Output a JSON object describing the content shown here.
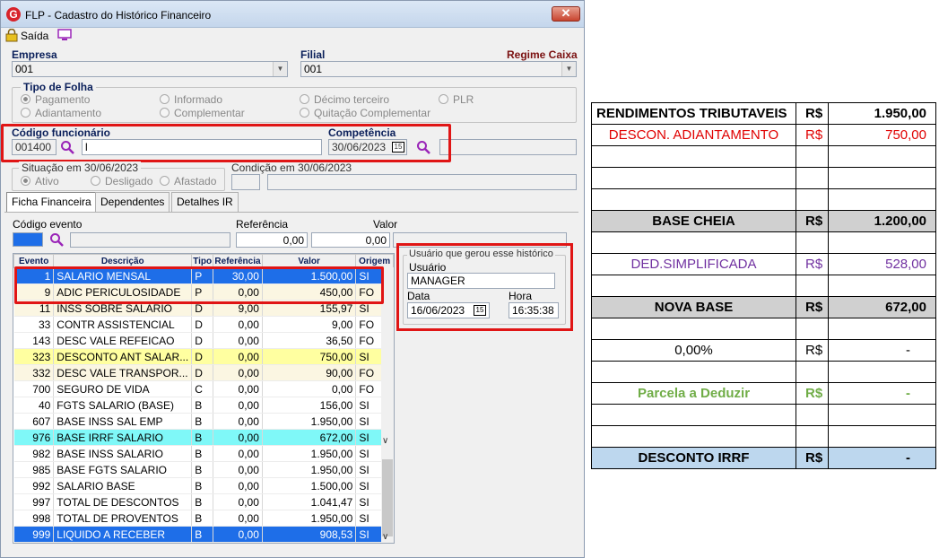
{
  "window": {
    "title": "FLP - Cadastro do Histórico Financeiro",
    "logo": "G",
    "close_label": "✕"
  },
  "toolbar": {
    "exit_label": "Saída"
  },
  "empresa": {
    "label": "Empresa",
    "value": "001"
  },
  "filial": {
    "label": "Filial",
    "value": "001",
    "regime": "Regime Caixa"
  },
  "tipo_folha": {
    "label": "Tipo de Folha",
    "options": [
      "Pagamento",
      "Informado",
      "Décimo terceiro",
      "PLR",
      "Adiantamento",
      "Complementar",
      "Quitação Complementar"
    ],
    "selected": "Pagamento"
  },
  "funcionario": {
    "label": "Código funcionário",
    "code": "001400",
    "name": "l"
  },
  "competencia": {
    "label": "Competência",
    "value": "30/06/2023",
    "cal": "15"
  },
  "situacao": {
    "label": "Situação em  30/06/2023",
    "options": [
      "Ativo",
      "Desligado",
      "Afastado"
    ],
    "selected": "Ativo"
  },
  "condicao": {
    "label": "Condição em 30/06/2023"
  },
  "tabs": [
    "Ficha Financeira",
    "Dependentes",
    "Detalhes IR"
  ],
  "evento_form": {
    "codigo_label": "Código evento",
    "ref_label": "Referência",
    "ref_value": "0,00",
    "valor_label": "Valor",
    "valor_value": "0,00"
  },
  "usuario_box": {
    "title": "Usuário que gerou esse histórico",
    "usuario_label": "Usuário",
    "usuario_value": "MANAGER",
    "data_label": "Data",
    "data_value": "16/06/2023",
    "data_cal": "15",
    "hora_label": "Hora",
    "hora_value": "16:35:38"
  },
  "grid": {
    "columns": [
      "Evento",
      "Descrição",
      "Tipo",
      "Referência",
      "Valor",
      "Origem"
    ],
    "rows": [
      {
        "evento": "1",
        "descricao": "SALARIO MENSAL",
        "tipo": "P",
        "ref": "30,00",
        "valor": "1.500,00",
        "origem": "SI",
        "style": "sel"
      },
      {
        "evento": "9",
        "descricao": "ADIC PERICULOSIDADE",
        "tipo": "P",
        "ref": "0,00",
        "valor": "450,00",
        "origem": "FO",
        "style": "cream"
      },
      {
        "evento": "11",
        "descricao": "INSS SOBRE SALARIO",
        "tipo": "D",
        "ref": "9,00",
        "valor": "155,97",
        "origem": "SI",
        "style": "cream"
      },
      {
        "evento": "33",
        "descricao": "CONTR ASSISTENCIAL",
        "tipo": "D",
        "ref": "0,00",
        "valor": "9,00",
        "origem": "FO",
        "style": "white"
      },
      {
        "evento": "143",
        "descricao": "DESC VALE REFEICAO",
        "tipo": "D",
        "ref": "0,00",
        "valor": "36,50",
        "origem": "FO",
        "style": "white"
      },
      {
        "evento": "323",
        "descricao": "DESCONTO ANT SALAR...",
        "tipo": "D",
        "ref": "0,00",
        "valor": "750,00",
        "origem": "SI",
        "style": "yellow"
      },
      {
        "evento": "332",
        "descricao": "DESC VALE TRANSPOR...",
        "tipo": "D",
        "ref": "0,00",
        "valor": "90,00",
        "origem": "FO",
        "style": "cream"
      },
      {
        "evento": "700",
        "descricao": "SEGURO DE VIDA",
        "tipo": "C",
        "ref": "0,00",
        "valor": "0,00",
        "origem": "FO",
        "style": "white"
      },
      {
        "evento": "40",
        "descricao": "FGTS SALARIO (BASE)",
        "tipo": "B",
        "ref": "0,00",
        "valor": "156,00",
        "origem": "SI",
        "style": "white"
      },
      {
        "evento": "607",
        "descricao": "BASE INSS SAL EMP",
        "tipo": "B",
        "ref": "0,00",
        "valor": "1.950,00",
        "origem": "SI",
        "style": "white"
      },
      {
        "evento": "976",
        "descricao": "BASE IRRF SALARIO",
        "tipo": "B",
        "ref": "0,00",
        "valor": "672,00",
        "origem": "SI",
        "style": "cyan"
      },
      {
        "evento": "982",
        "descricao": "BASE INSS SALARIO",
        "tipo": "B",
        "ref": "0,00",
        "valor": "1.950,00",
        "origem": "SI",
        "style": "white"
      },
      {
        "evento": "985",
        "descricao": "BASE FGTS SALARIO",
        "tipo": "B",
        "ref": "0,00",
        "valor": "1.950,00",
        "origem": "SI",
        "style": "white"
      },
      {
        "evento": "992",
        "descricao": "SALARIO BASE",
        "tipo": "B",
        "ref": "0,00",
        "valor": "1.500,00",
        "origem": "SI",
        "style": "white"
      },
      {
        "evento": "997",
        "descricao": "TOTAL DE DESCONTOS",
        "tipo": "B",
        "ref": "0,00",
        "valor": "1.041,47",
        "origem": "SI",
        "style": "white"
      },
      {
        "evento": "998",
        "descricao": "TOTAL DE PROVENTOS",
        "tipo": "B",
        "ref": "0,00",
        "valor": "1.950,00",
        "origem": "SI",
        "style": "white"
      },
      {
        "evento": "999",
        "descricao": "LIQUIDO A RECEBER",
        "tipo": "B",
        "ref": "0,00",
        "valor": "908,53",
        "origem": "SI",
        "style": "blue"
      }
    ]
  },
  "calc": {
    "currency": "R$",
    "rows": [
      {
        "label": "RENDIMENTOS TRIBUTAVEIS",
        "value": "1.950,00",
        "color": "#000000",
        "bold": true,
        "bg": "#ffffff",
        "cur": true,
        "align": "left"
      },
      {
        "label": "DESCON. ADIANTAMENTO",
        "value": "750,00",
        "color": "#e00000",
        "bold": false,
        "bg": "#ffffff",
        "cur": true,
        "align": "center"
      },
      {
        "label": "",
        "value": "",
        "bg": "#ffffff"
      },
      {
        "label": "",
        "value": "",
        "bg": "#ffffff"
      },
      {
        "label": "",
        "value": "",
        "bg": "#ffffff"
      },
      {
        "label": "BASE CHEIA",
        "value": "1.200,00",
        "color": "#000000",
        "bold": true,
        "bg": "#d0d0d0",
        "cur": true,
        "align": "center"
      },
      {
        "label": "",
        "value": "",
        "bg": "#ffffff"
      },
      {
        "label": "DED.SIMPLIFICADA",
        "value": "528,00",
        "color": "#7030a0",
        "bold": false,
        "bg": "#ffffff",
        "cur": true,
        "align": "center"
      },
      {
        "label": "",
        "value": "",
        "bg": "#ffffff"
      },
      {
        "label": "NOVA BASE",
        "value": "672,00",
        "color": "#000000",
        "bold": true,
        "bg": "#d0d0d0",
        "cur": true,
        "align": "center"
      },
      {
        "label": "",
        "value": "",
        "bg": "#ffffff"
      },
      {
        "label": "0,00%",
        "value": "-",
        "color": "#000000",
        "bold": false,
        "bg": "#ffffff",
        "cur": true,
        "align": "center"
      },
      {
        "label": "",
        "value": "",
        "bg": "#ffffff"
      },
      {
        "label": "Parcela a Deduzir",
        "value": "-",
        "color": "#70ad47",
        "bold": true,
        "bg": "#ffffff",
        "cur": true,
        "align": "center"
      },
      {
        "label": "",
        "value": "",
        "bg": "#ffffff"
      },
      {
        "label": "",
        "value": "",
        "bg": "#ffffff"
      },
      {
        "label": "DESCONTO IRRF",
        "value": "-",
        "color": "#000000",
        "bold": true,
        "bg": "#bdd7ee",
        "cur": true,
        "align": "center"
      }
    ]
  }
}
